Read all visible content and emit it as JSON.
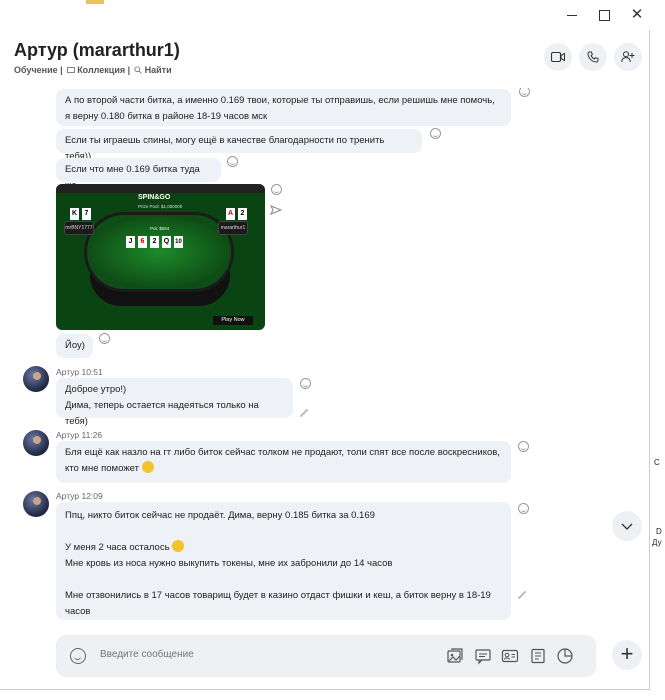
{
  "window": {
    "close_glyph": "✕"
  },
  "header": {
    "title": "Артур (mararthur1)",
    "nav": [
      "Обучение |",
      "Коллекция |",
      "Найти"
    ],
    "icons": [
      "video-call-icon",
      "audio-call-icon",
      "add-person-icon"
    ]
  },
  "messages": [
    {
      "text": "А по второй части битка, а именно 0.169 твои, которые ты отправишь, если решишь мне помочь, я верну 0.180 битка в районе 18-19 часов мск"
    },
    {
      "text": "Если ты играешь спины, могу ещё в качестве благодарности по тренить тебя))"
    },
    {
      "text": "Если что мне 0.169 битка туда же"
    },
    {
      "image": {
        "logo": "SPIN&GO",
        "prize": "Prize Pool: $1,000000",
        "pot": "Pot: $584",
        "player_left": "mrBNY1777",
        "player_right": "mararthur1",
        "board": [
          "J",
          "6",
          "2",
          "Q",
          "10"
        ],
        "hand_left": [
          "K",
          "7"
        ],
        "hand_right": [
          "A",
          "2"
        ],
        "button": "Play Now"
      }
    },
    {
      "text": "Йоу)"
    },
    {
      "sender": "Артур",
      "time": "10:51",
      "lines": [
        "Доброе утро!)",
        "Дима, теперь остается надеяться только  на тебя)"
      ]
    },
    {
      "sender": "Артур",
      "time": "11:26",
      "text": "Бля ещё как назло на гт либо биток сейчас толком не продают, толи спят все после воскресников, кто мне поможет"
    },
    {
      "sender": "Артур",
      "time": "12:09",
      "lines": [
        "Ппц, никто биток сейчас не продаёт. Дима, верну 0.185 битка за 0.169",
        "",
        "У меня 2 часа осталось",
        "Мне кровь из носа нужно выкупить токены, мне их забронили до 14 часов",
        "",
        "Мне отзвонились в 17 часов товарищ будет в казино отдаст фишки и кеш, а биток верну в 18-19 часов"
      ]
    }
  ],
  "composer": {
    "placeholder": "Введите сообщение"
  },
  "colors": {
    "bubble": "#eef1f5",
    "felt": "#1e8a2a"
  },
  "background": {
    "right_edge_text": [
      "С",
      "D",
      "Ду"
    ]
  }
}
